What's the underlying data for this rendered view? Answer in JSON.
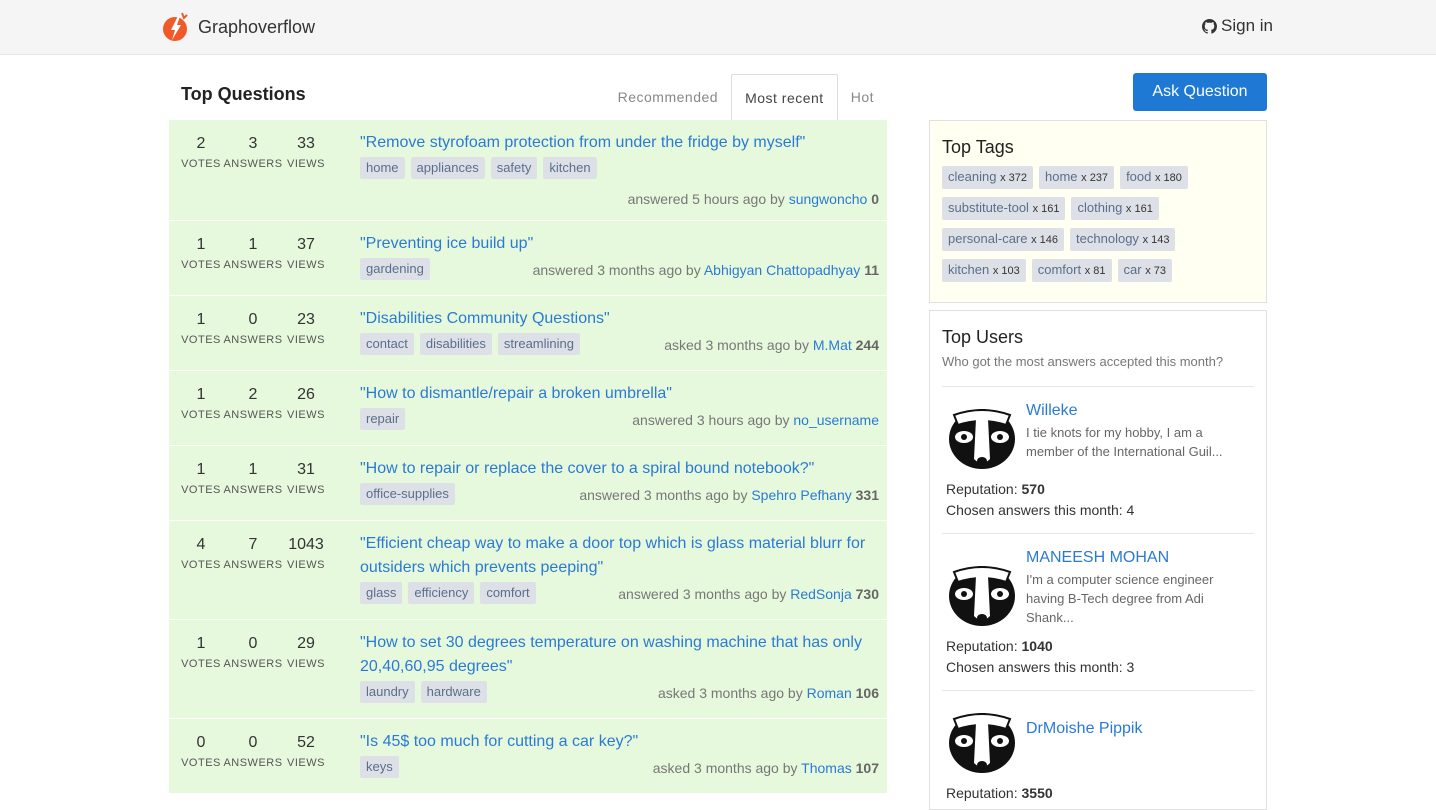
{
  "nav": {
    "brand": "Graphoverflow",
    "signin": "Sign in"
  },
  "main": {
    "title": "Top Questions",
    "tabs": [
      "Recommended",
      "Most recent",
      "Hot"
    ],
    "active_tab": "Most recent",
    "stat_labels": {
      "votes": "VOTES",
      "answers": "ANSWERS",
      "views": "VIEWS"
    }
  },
  "questions": [
    {
      "votes": "2",
      "answers": "3",
      "views": "33",
      "title": "\"Remove styrofoam protection from under the fridge by myself\"",
      "tags": [
        "home",
        "appliances",
        "safety",
        "kitchen"
      ],
      "meta": "answered 5 hours ago by",
      "user": "sungwoncho",
      "rep": "0"
    },
    {
      "votes": "1",
      "answers": "1",
      "views": "37",
      "title": "\"Preventing ice build up\"",
      "tags": [
        "gardening"
      ],
      "meta": "answered 3 months ago by",
      "user": "Abhigyan Chattopadhyay",
      "rep": "11"
    },
    {
      "votes": "1",
      "answers": "0",
      "views": "23",
      "title": "\"Disabilities Community Questions\"",
      "tags": [
        "contact",
        "disabilities",
        "streamlining"
      ],
      "meta": "asked 3 months ago by",
      "user": "M.Mat",
      "rep": "244"
    },
    {
      "votes": "1",
      "answers": "2",
      "views": "26",
      "title": "\"How to dismantle/repair a broken umbrella\"",
      "tags": [
        "repair"
      ],
      "meta": "answered 3 hours ago by",
      "user": "no_username",
      "rep": ""
    },
    {
      "votes": "1",
      "answers": "1",
      "views": "31",
      "title": "\"How to repair or replace the cover to a spiral bound notebook?\"",
      "tags": [
        "office-supplies"
      ],
      "meta": "answered 3 months ago by",
      "user": "Spehro Pefhany",
      "rep": "331"
    },
    {
      "votes": "4",
      "answers": "7",
      "views": "1043",
      "title": "\"Efficient cheap way to make a door top which is glass material blurr for outsiders which prevents peeping\"",
      "tags": [
        "glass",
        "efficiency",
        "comfort"
      ],
      "meta": "answered 3 months ago by",
      "user": "RedSonja",
      "rep": "730"
    },
    {
      "votes": "1",
      "answers": "0",
      "views": "29",
      "title": "\"How to set 30 degrees temperature on washing machine that has only 20,40,60,95 degrees\"",
      "tags": [
        "laundry",
        "hardware"
      ],
      "meta": "asked 3 months ago by",
      "user": "Roman",
      "rep": "106"
    },
    {
      "votes": "0",
      "answers": "0",
      "views": "52",
      "title": "\"Is 45$ too much for cutting a car key?\"",
      "tags": [
        "keys"
      ],
      "meta": "asked 3 months ago by",
      "user": "Thomas",
      "rep": "107"
    }
  ],
  "sidebar": {
    "ask_button": "Ask Question",
    "top_tags_title": "Top Tags",
    "top_tags": [
      {
        "name": "cleaning",
        "count": "x 372"
      },
      {
        "name": "home",
        "count": "x 237"
      },
      {
        "name": "food",
        "count": "x 180"
      },
      {
        "name": "substitute-tool",
        "count": "x 161"
      },
      {
        "name": "clothing",
        "count": "x 161"
      },
      {
        "name": "personal-care",
        "count": "x 146"
      },
      {
        "name": "technology",
        "count": "x 143"
      },
      {
        "name": "kitchen",
        "count": "x 103"
      },
      {
        "name": "comfort",
        "count": "x 81"
      },
      {
        "name": "car",
        "count": "x 73"
      }
    ],
    "top_users_title": "Top Users",
    "top_users_subtitle": "Who got the most answers accepted this month?",
    "reputation_label": "Reputation:",
    "chosen_label": "Chosen answers this month:",
    "users": [
      {
        "name": "Willeke",
        "bio": "I tie knots for my hobby, I am a member of the International Guil...",
        "reputation": "570",
        "chosen": "4"
      },
      {
        "name": "MANEESH MOHAN",
        "bio": "I'm a computer science engineer having B-Tech degree from Adi Shank...",
        "reputation": "1040",
        "chosen": "3"
      },
      {
        "name": "DrMoishe Pippik",
        "bio": "",
        "reputation": "3550",
        "chosen": ""
      }
    ]
  },
  "colors": {
    "accent": "#1d79d3",
    "link": "#2a7ad4",
    "row_bg": "#e7f9dd",
    "logo": "#f0592a"
  },
  "icons": {
    "brand": "lightning-logo-icon",
    "signin": "github-icon",
    "avatar": "badger-avatar-icon"
  }
}
